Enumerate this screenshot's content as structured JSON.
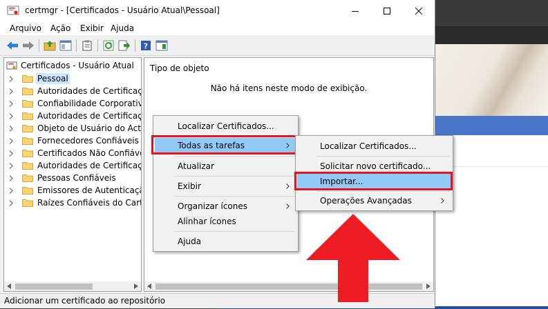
{
  "window": {
    "title": "certmgr - [Certificados - Usuário Atual\\Pessoal]"
  },
  "menubar": [
    "Arquivo",
    "Ação",
    "Exibir",
    "Ajuda"
  ],
  "tree": {
    "root": "Certificados - Usuário Atual",
    "items": [
      {
        "label": "Pessoal",
        "selected": true
      },
      {
        "label": "Autoridades de Certificação R"
      },
      {
        "label": "Confiabilidade Corporativa"
      },
      {
        "label": "Autoridades de Certificação I"
      },
      {
        "label": "Objeto de Usuário do Active D"
      },
      {
        "label": "Fornecedores Confiáveis"
      },
      {
        "label": "Certificados Não Confiáveis"
      },
      {
        "label": "Autoridades de Certificação R"
      },
      {
        "label": "Pessoas Confiáveis"
      },
      {
        "label": "Emissores de Autenticação de"
      },
      {
        "label": "Raízes Confiáveis do Cartão In"
      }
    ]
  },
  "content": {
    "column_header": "Tipo de objeto",
    "empty_message": "Não há itens neste modo de exibição."
  },
  "context_menu": {
    "items": [
      "Localizar Certificados...",
      "Todas as tarefas",
      "Atualizar",
      "Exibir",
      "Organizar ícones",
      "Alinhar ícones",
      "Ajuda"
    ]
  },
  "submenu": {
    "items": [
      "Localizar Certificados...",
      "Solicitar novo certificado...",
      "Importar...",
      "Operações Avançadas"
    ]
  },
  "status_bar": "Adicionar um certificado ao repositório",
  "colors": {
    "highlight": "#91c9f7",
    "annotation_red": "#e8131e",
    "selection": "#cce8ff"
  }
}
